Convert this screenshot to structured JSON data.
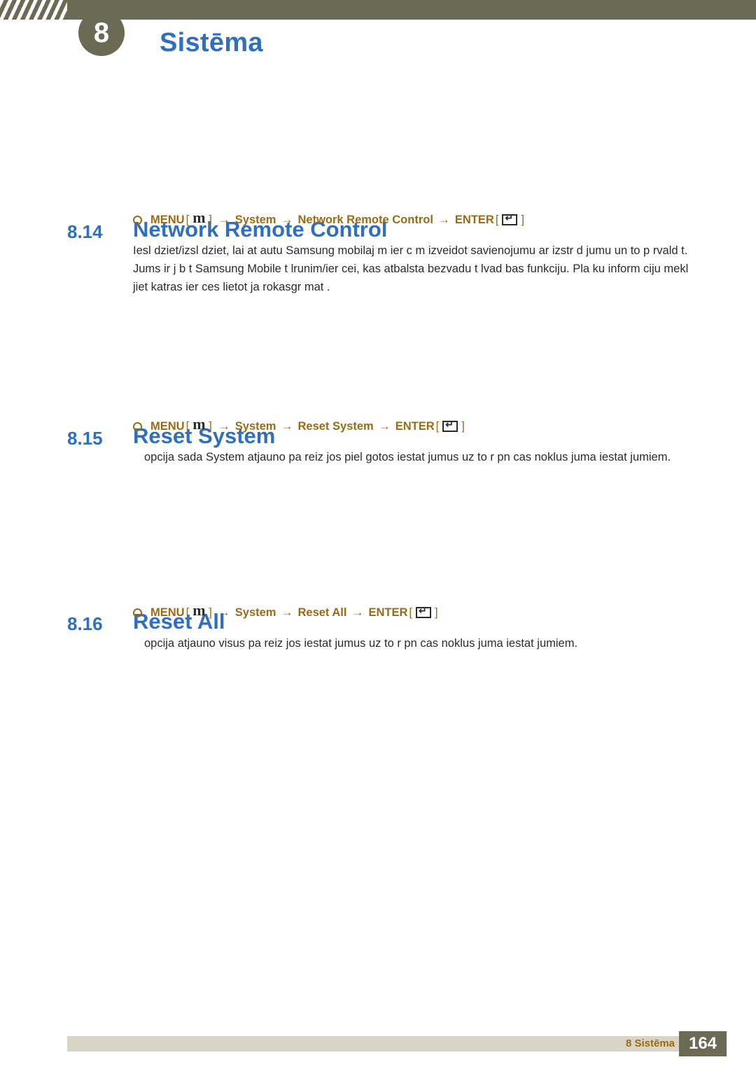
{
  "header": {
    "chapter_number": "8",
    "chapter_title": "Sistēma",
    "hatch_icon": "diagonal-stripes-decoration"
  },
  "sections": [
    {
      "number": "8.14",
      "title": "Network Remote Control",
      "menu_path": {
        "bullet": "circle-bullet",
        "menu_label": "MENU",
        "m_key": "m",
        "arrow1": "→",
        "item1": "System",
        "arrow2": "→",
        "item2": "Network Remote Control",
        "arrow3": "→",
        "enter_label": "ENTER",
        "enter_key": "enter-key-glyph",
        "bracket_open": "[",
        "bracket_close": "]"
      },
      "body": "Iesl dziet/izsl dziet, lai at autu Samsung mobilaj m ier c m izveidot savienojumu ar izstr d jumu un to p rvald t. Jums ir j b t Samsung Mobile t lrunim/ier cei, kas atbalsta bezvadu t lvad bas funkciju. Pla  ku inform ciju mekl jiet katras  ier ces lietot ja rokasgr mat ."
    },
    {
      "number": "8.15",
      "title": "Reset System",
      "menu_path": {
        "bullet": "circle-bullet",
        "menu_label": "MENU",
        "m_key": "m",
        "arrow1": "→",
        "item1": "System",
        "arrow2": "→",
        "item2": "Reset System",
        "arrow3": "→",
        "enter_label": "ENTER",
        "enter_key": "enter-key-glyph",
        "bracket_open": "[",
        "bracket_close": "]"
      },
      "body": "opcija sada  System atjauno pa reiz jos piel gotos iestat jumus uz to r pn cas noklus juma iestat jumiem."
    },
    {
      "number": "8.16",
      "title": "Reset All",
      "menu_path": {
        "bullet": "circle-bullet",
        "menu_label": "MENU",
        "m_key": "m",
        "arrow1": "→",
        "item1": "System",
        "arrow2": "→",
        "item2": "Reset All",
        "arrow3": "→",
        "enter_label": "ENTER",
        "enter_key": "enter-key-glyph",
        "bracket_open": "[",
        "bracket_close": "]"
      },
      "body": "opcija atjauno visus pa reiz jos iestat jumus uz to r pn cas noklus juma iestat jumiem."
    }
  ],
  "footer": {
    "chapter_ref": "8 Sistēma",
    "page_number": "164"
  },
  "colors": {
    "heading_blue": "#2f6fbf",
    "menu_gold": "#9a6a14",
    "band_olive": "#6b6a55",
    "footer_band": "#d9d5c6"
  }
}
